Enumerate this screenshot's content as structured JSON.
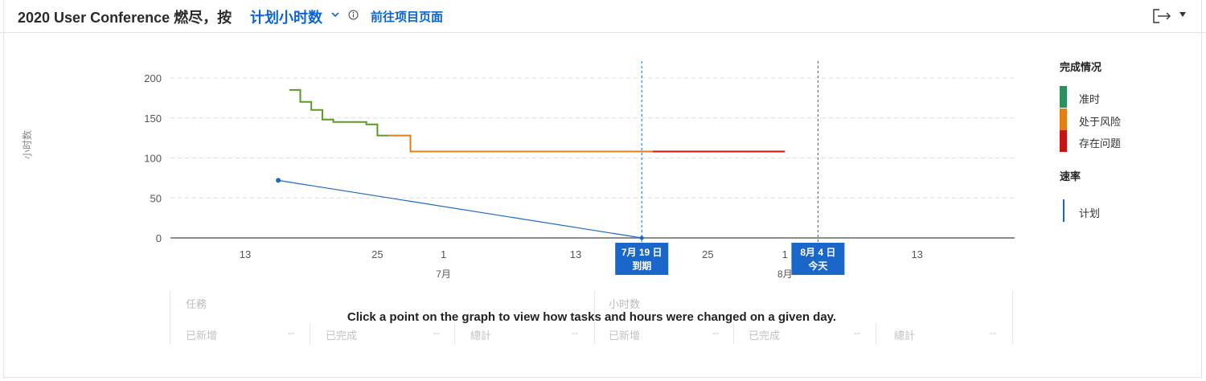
{
  "header": {
    "title": "2020 User Conference 燃尽，按",
    "measure_dropdown": "计划小时数",
    "project_link": "前往项目页面"
  },
  "chart_data": {
    "type": "line",
    "ylabel": "小时数",
    "ylim": [
      0,
      200
    ],
    "y_ticks": [
      0,
      50,
      100,
      150,
      200
    ],
    "x_tick_labels": [
      "13",
      "25",
      "1",
      "13",
      "25",
      "1",
      "13"
    ],
    "month_labels": [
      "7月",
      "8月"
    ],
    "markers": [
      {
        "label_line1": "7月 19 日",
        "label_line2": "到期",
        "date": "2020-07-19"
      },
      {
        "label_line1": "8月 4 日",
        "label_line2": "今天",
        "date": "2020-08-04"
      }
    ],
    "series": [
      {
        "name": "准时",
        "color": "#5a9a2a",
        "points": [
          [
            "2020-06-17",
            185
          ],
          [
            "2020-06-18",
            185
          ],
          [
            "2020-06-18",
            170
          ],
          [
            "2020-06-19",
            170
          ],
          [
            "2020-06-19",
            160
          ],
          [
            "2020-06-20",
            160
          ],
          [
            "2020-06-20",
            148
          ],
          [
            "2020-06-21",
            148
          ],
          [
            "2020-06-21",
            145
          ],
          [
            "2020-06-24",
            145
          ],
          [
            "2020-06-24",
            142
          ],
          [
            "2020-06-25",
            142
          ],
          [
            "2020-06-25",
            128
          ],
          [
            "2020-06-26",
            128
          ]
        ]
      },
      {
        "name": "处于风险",
        "color": "#e07f16",
        "points": [
          [
            "2020-06-26",
            128
          ],
          [
            "2020-06-28",
            128
          ],
          [
            "2020-06-28",
            108
          ],
          [
            "2020-07-20",
            108
          ]
        ]
      },
      {
        "name": "存在问题",
        "color": "#c81313",
        "points": [
          [
            "2020-07-20",
            108
          ],
          [
            "2020-08-01",
            108
          ]
        ]
      },
      {
        "name": "计划",
        "color": "#1a66c9",
        "points": [
          [
            "2020-06-16",
            72
          ],
          [
            "2020-07-19",
            0
          ]
        ]
      }
    ]
  },
  "legend": {
    "completion_title": "完成情况",
    "items": [
      {
        "label": "准时",
        "color": "#2e8f5e"
      },
      {
        "label": "处于风险",
        "color": "#e07f16"
      },
      {
        "label": "存在问题",
        "color": "#c81313"
      }
    ],
    "velocity_title": "速率",
    "velocity_item": "计划",
    "velocity_color": "#1a66c9"
  },
  "table": {
    "tasks_header": "任務",
    "hours_header": "小时数",
    "message": "Click a point on the graph to view how tasks and hours were changed on a given day.",
    "columns": [
      "已新增",
      "已完成",
      "總計",
      "已新增",
      "已完成",
      "總計"
    ],
    "placeholder": "--"
  }
}
